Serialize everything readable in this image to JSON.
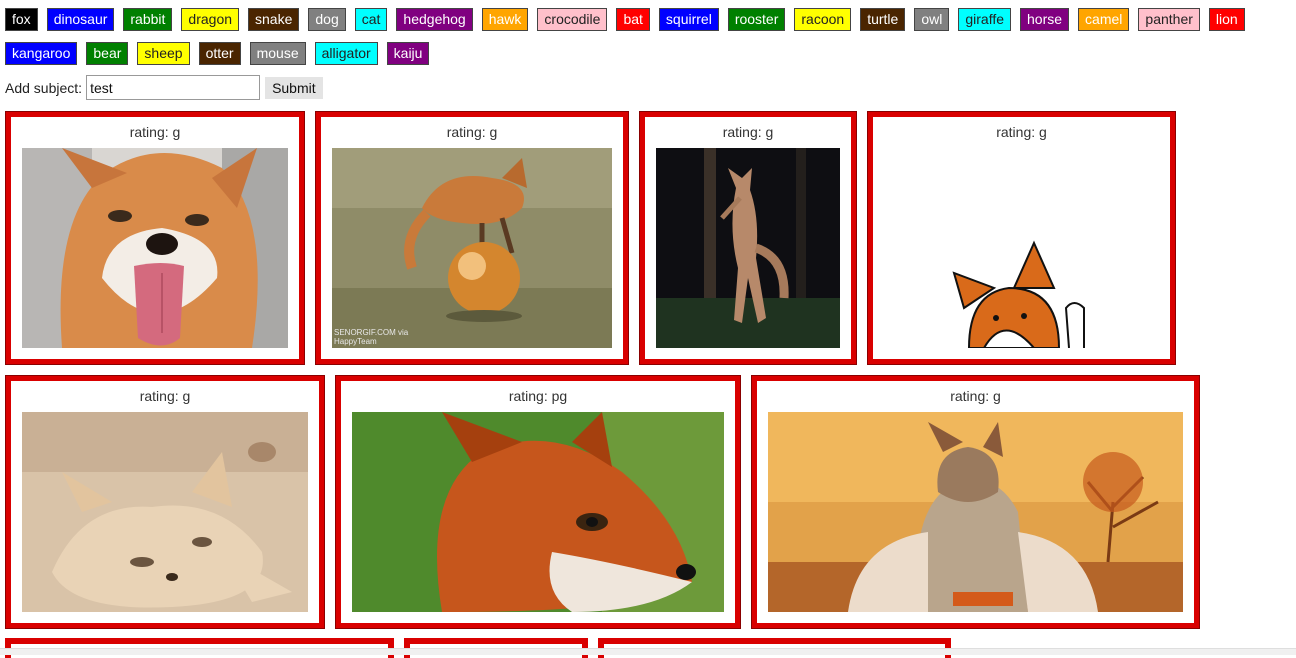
{
  "subjects_row1": [
    {
      "label": "fox",
      "bg": "#000000",
      "fg": "#ffffff"
    },
    {
      "label": "dinosaur",
      "bg": "#0000ff",
      "fg": "#ffffff"
    },
    {
      "label": "rabbit",
      "bg": "#008000",
      "fg": "#ffffff"
    },
    {
      "label": "dragon",
      "bg": "#ffff00",
      "fg": "#222222"
    },
    {
      "label": "snake",
      "bg": "#4a2500",
      "fg": "#ffffff"
    },
    {
      "label": "dog",
      "bg": "#808080",
      "fg": "#ffffff"
    },
    {
      "label": "cat",
      "bg": "#00ffff",
      "fg": "#222222"
    },
    {
      "label": "hedgehog",
      "bg": "#800080",
      "fg": "#ffffff"
    },
    {
      "label": "hawk",
      "bg": "#ffa500",
      "fg": "#ffffff"
    },
    {
      "label": "crocodile",
      "bg": "#ffc0cb",
      "fg": "#222222"
    },
    {
      "label": "bat",
      "bg": "#ff0000",
      "fg": "#ffffff"
    },
    {
      "label": "squirrel",
      "bg": "#0000ff",
      "fg": "#ffffff"
    },
    {
      "label": "rooster",
      "bg": "#008000",
      "fg": "#ffffff"
    },
    {
      "label": "racoon",
      "bg": "#ffff00",
      "fg": "#222222"
    },
    {
      "label": "turtle",
      "bg": "#4a2500",
      "fg": "#ffffff"
    },
    {
      "label": "owl",
      "bg": "#808080",
      "fg": "#ffffff"
    },
    {
      "label": "giraffe",
      "bg": "#00ffff",
      "fg": "#222222"
    },
    {
      "label": "horse",
      "bg": "#800080",
      "fg": "#ffffff"
    },
    {
      "label": "camel",
      "bg": "#ffa500",
      "fg": "#ffffff"
    },
    {
      "label": "panther",
      "bg": "#ffc0cb",
      "fg": "#222222"
    },
    {
      "label": "lion",
      "bg": "#ff0000",
      "fg": "#ffffff"
    }
  ],
  "subjects_row2": [
    {
      "label": "kangaroo",
      "bg": "#0000ff",
      "fg": "#ffffff"
    },
    {
      "label": "bear",
      "bg": "#008000",
      "fg": "#ffffff"
    },
    {
      "label": "sheep",
      "bg": "#ffff00",
      "fg": "#222222"
    },
    {
      "label": "otter",
      "bg": "#4a2500",
      "fg": "#ffffff"
    },
    {
      "label": "mouse",
      "bg": "#808080",
      "fg": "#ffffff"
    },
    {
      "label": "alligator",
      "bg": "#00ffff",
      "fg": "#222222"
    },
    {
      "label": "kaiju",
      "bg": "#800080",
      "fg": "#ffffff"
    }
  ],
  "form": {
    "label": "Add subject:",
    "value": "test",
    "submit_label": "Submit"
  },
  "cards": [
    {
      "rating": "rating: g",
      "scene": "fox-tongue"
    },
    {
      "rating": "rating: g",
      "scene": "fox-ball",
      "watermark": "SENORGIF.COM via HappyTeam"
    },
    {
      "rating": "rating: g",
      "scene": "fox-night"
    },
    {
      "rating": "rating: g",
      "scene": "fox-cartoon"
    },
    {
      "rating": "rating: g",
      "scene": "fox-cubs"
    },
    {
      "rating": "rating: pg",
      "scene": "fox-portrait"
    },
    {
      "rating": "rating: g",
      "scene": "fox-mr"
    }
  ],
  "colors": {
    "card_border": "#d90000"
  }
}
